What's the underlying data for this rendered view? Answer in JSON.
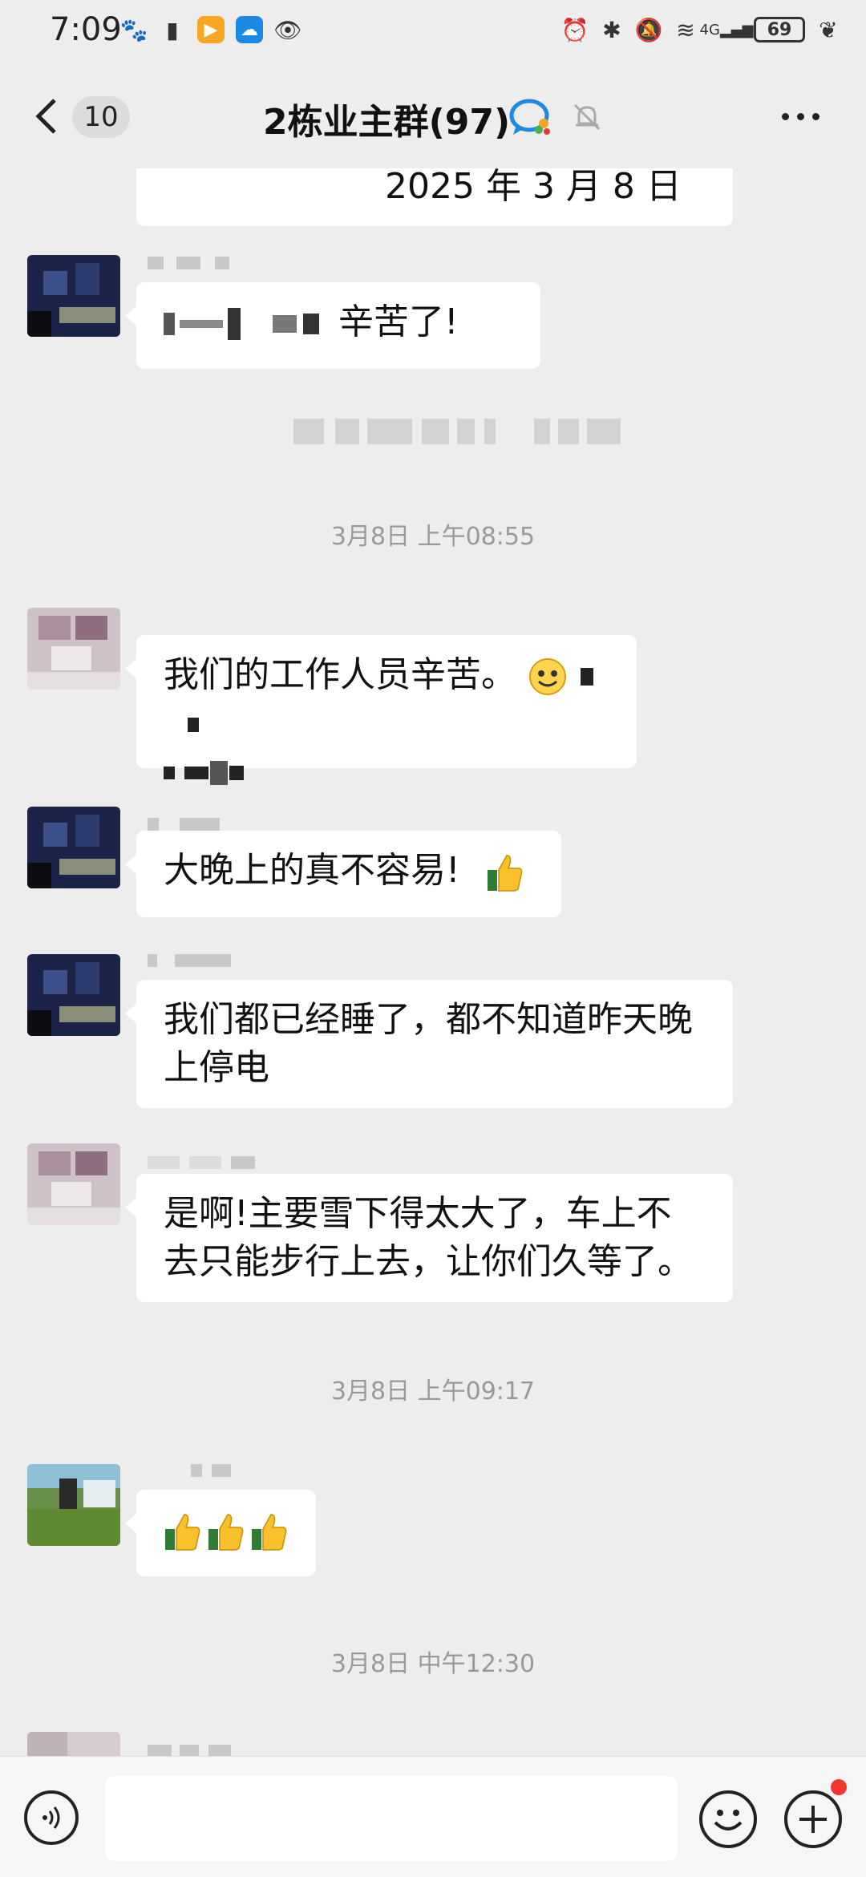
{
  "status_bar": {
    "time": "7:09",
    "battery": "69",
    "signal_label": "4G"
  },
  "header": {
    "back_count": "10",
    "title": "2栋业主群(97)"
  },
  "messages": {
    "top_partial": "2025 年 3 月 8 日",
    "m1_text": "辛苦了!",
    "ts1": "3月8日 上午08:55",
    "m2_text": "我们的工作人员辛苦。",
    "m3_text": "大晚上的真不容易!",
    "m4_text": "我们都已经睡了，都不知道昨天晚上停电",
    "m5_text": "是啊!主要雪下得太大了，车上不去只能步行上去，让你们久等了。",
    "ts2": "3月8日 上午09:17",
    "ts3": "3月8日 中午12:30"
  },
  "input_bar": {
    "placeholder": ""
  },
  "icons": {
    "back": "chevron-left-icon",
    "title_badge": "wecom-chat-icon",
    "mute": "bell-off-icon",
    "more": "more-dots-icon",
    "voice": "voice-icon",
    "emoji": "emoji-icon",
    "plus": "plus-icon",
    "thumb": "thumbs-up-icon"
  },
  "colors": {
    "background": "#ededed",
    "bubble": "#ffffff",
    "badge_red": "#f43530",
    "timestamp": "#999999"
  }
}
